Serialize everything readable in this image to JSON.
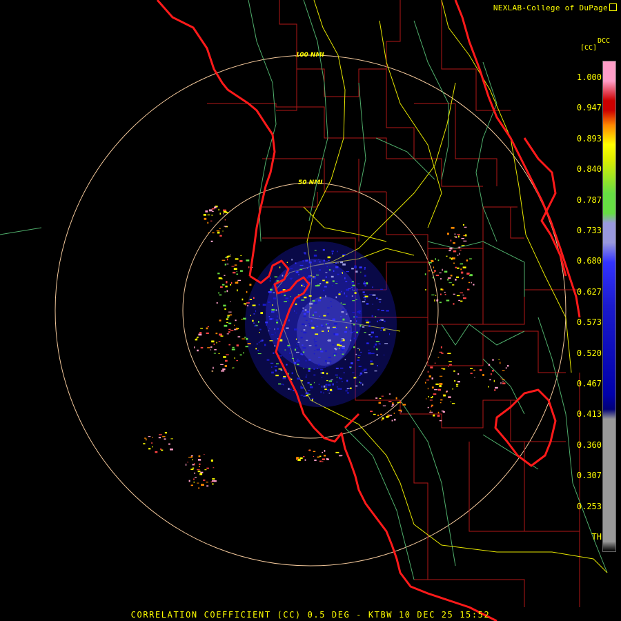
{
  "header": {
    "credit": "NEXLAB-College of DuPage"
  },
  "legend": {
    "product_code": "DCC",
    "units": "[CC]",
    "ticks": [
      "1.000",
      "0.947",
      "0.893",
      "0.840",
      "0.787",
      "0.733",
      "0.680",
      "0.627",
      "0.573",
      "0.520",
      "0.467",
      "0.413",
      "0.360",
      "0.307",
      "0.253",
      "TH"
    ],
    "colors": {
      "top": "#ff9ec8",
      "red": "#cc0000",
      "orange": "#ff8800",
      "yellow": "#ffff00",
      "green": "#66dd44",
      "lavender": "#9999dd",
      "blue": "#1a1acc",
      "gray": "#999999",
      "black": "#000000"
    }
  },
  "range_rings": {
    "inner_label": "50 NMI",
    "outer_label": "100 NMI"
  },
  "footer": {
    "caption": "CORRELATION COEFFICIENT (CC) 0.5 DEG - KTBW 10 DEC 25 15:52"
  },
  "map_colors": {
    "coast": "#ff1a1a",
    "county": "#b31717",
    "highway": "#e6e600",
    "river": "#4fae6b",
    "ring": "#f2c79a"
  }
}
